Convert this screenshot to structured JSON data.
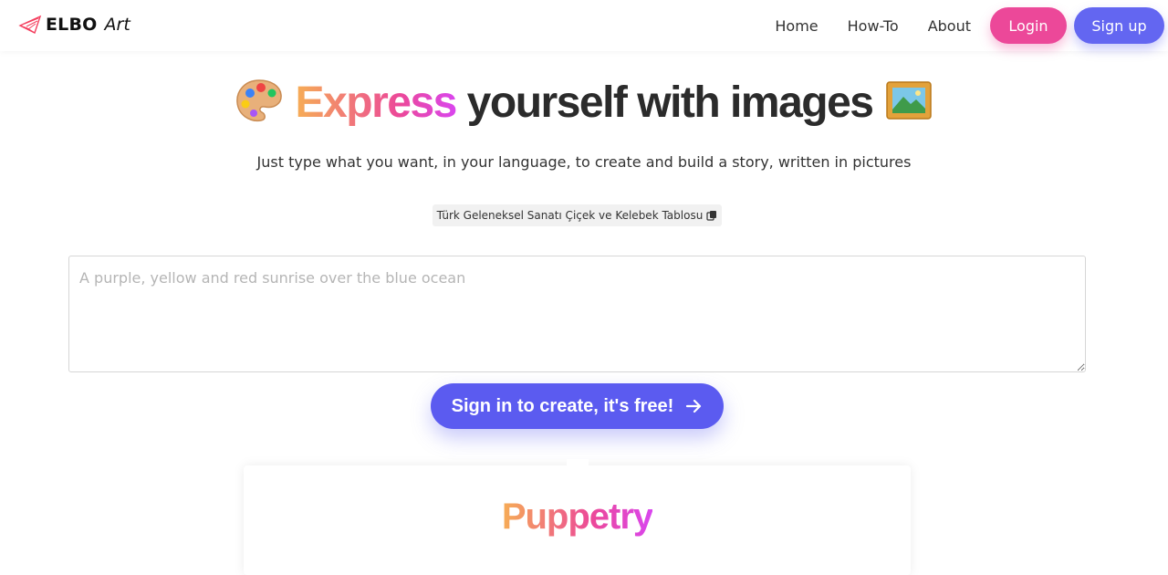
{
  "nav": {
    "brand_name": "ELBO",
    "brand_suffix": "Art",
    "links": [
      "Home",
      "How-To",
      "About"
    ],
    "login_label": "Login",
    "signup_label": "Sign up"
  },
  "hero": {
    "title_highlight": "Express",
    "title_rest": "yourself with images",
    "subtitle": "Just type what you want, in your language, to create and build a story, written in pictures"
  },
  "suggestion": {
    "text": "Türk Geleneksel Sanatı Çiçek ve Kelebek Tablosu"
  },
  "prompt": {
    "placeholder": "A purple, yellow and red sunrise over the blue ocean",
    "value": ""
  },
  "cta": {
    "label": "Sign in to create, it's free!"
  },
  "card": {
    "title": "Puppetry"
  },
  "colors": {
    "login": "#ec4899",
    "signup": "#6366f1",
    "cta": "#5b5bf0",
    "gradient_start": "#f6ad55",
    "gradient_end": "#d946ef"
  },
  "icons": [
    "paper-plane-logo-icon",
    "artist-palette-icon",
    "framed-picture-icon",
    "copy-icon",
    "arrow-right-icon"
  ]
}
